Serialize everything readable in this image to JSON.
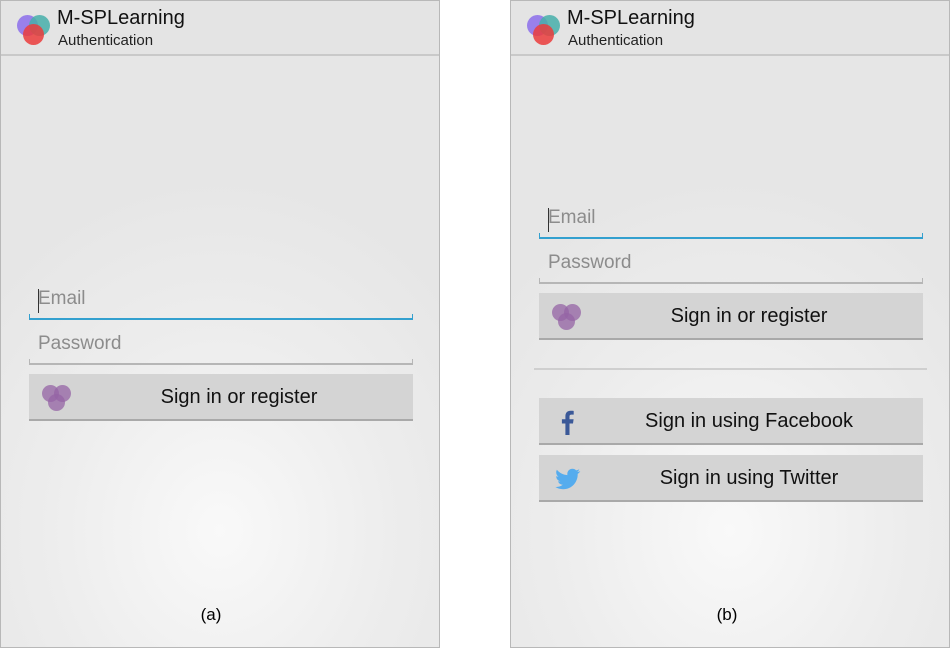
{
  "panels": [
    {
      "app_title": "M-SPLearning",
      "app_subtitle": "Authentication",
      "email_placeholder": "Email",
      "password_placeholder": "Password",
      "signin_label": "Sign in or register",
      "caption": "(a)"
    },
    {
      "app_title": "M-SPLearning",
      "app_subtitle": "Authentication",
      "email_placeholder": "Email",
      "password_placeholder": "Password",
      "signin_label": "Sign in or register",
      "facebook_label": "Sign in using Facebook",
      "twitter_label": "Sign in using Twitter",
      "caption": "(b)"
    }
  ],
  "colors": {
    "focus_underline": "#33a0cf",
    "facebook_blue": "#3b5998",
    "twitter_blue": "#55acee",
    "app_icon_purple": "#8c6eeb",
    "app_icon_teal": "#46afaa",
    "app_icon_red": "#eb3c3c"
  },
  "icons": {
    "app": "app-logo-icon",
    "signin": "app-circles-icon",
    "facebook": "facebook-icon",
    "twitter": "twitter-bird-icon"
  }
}
